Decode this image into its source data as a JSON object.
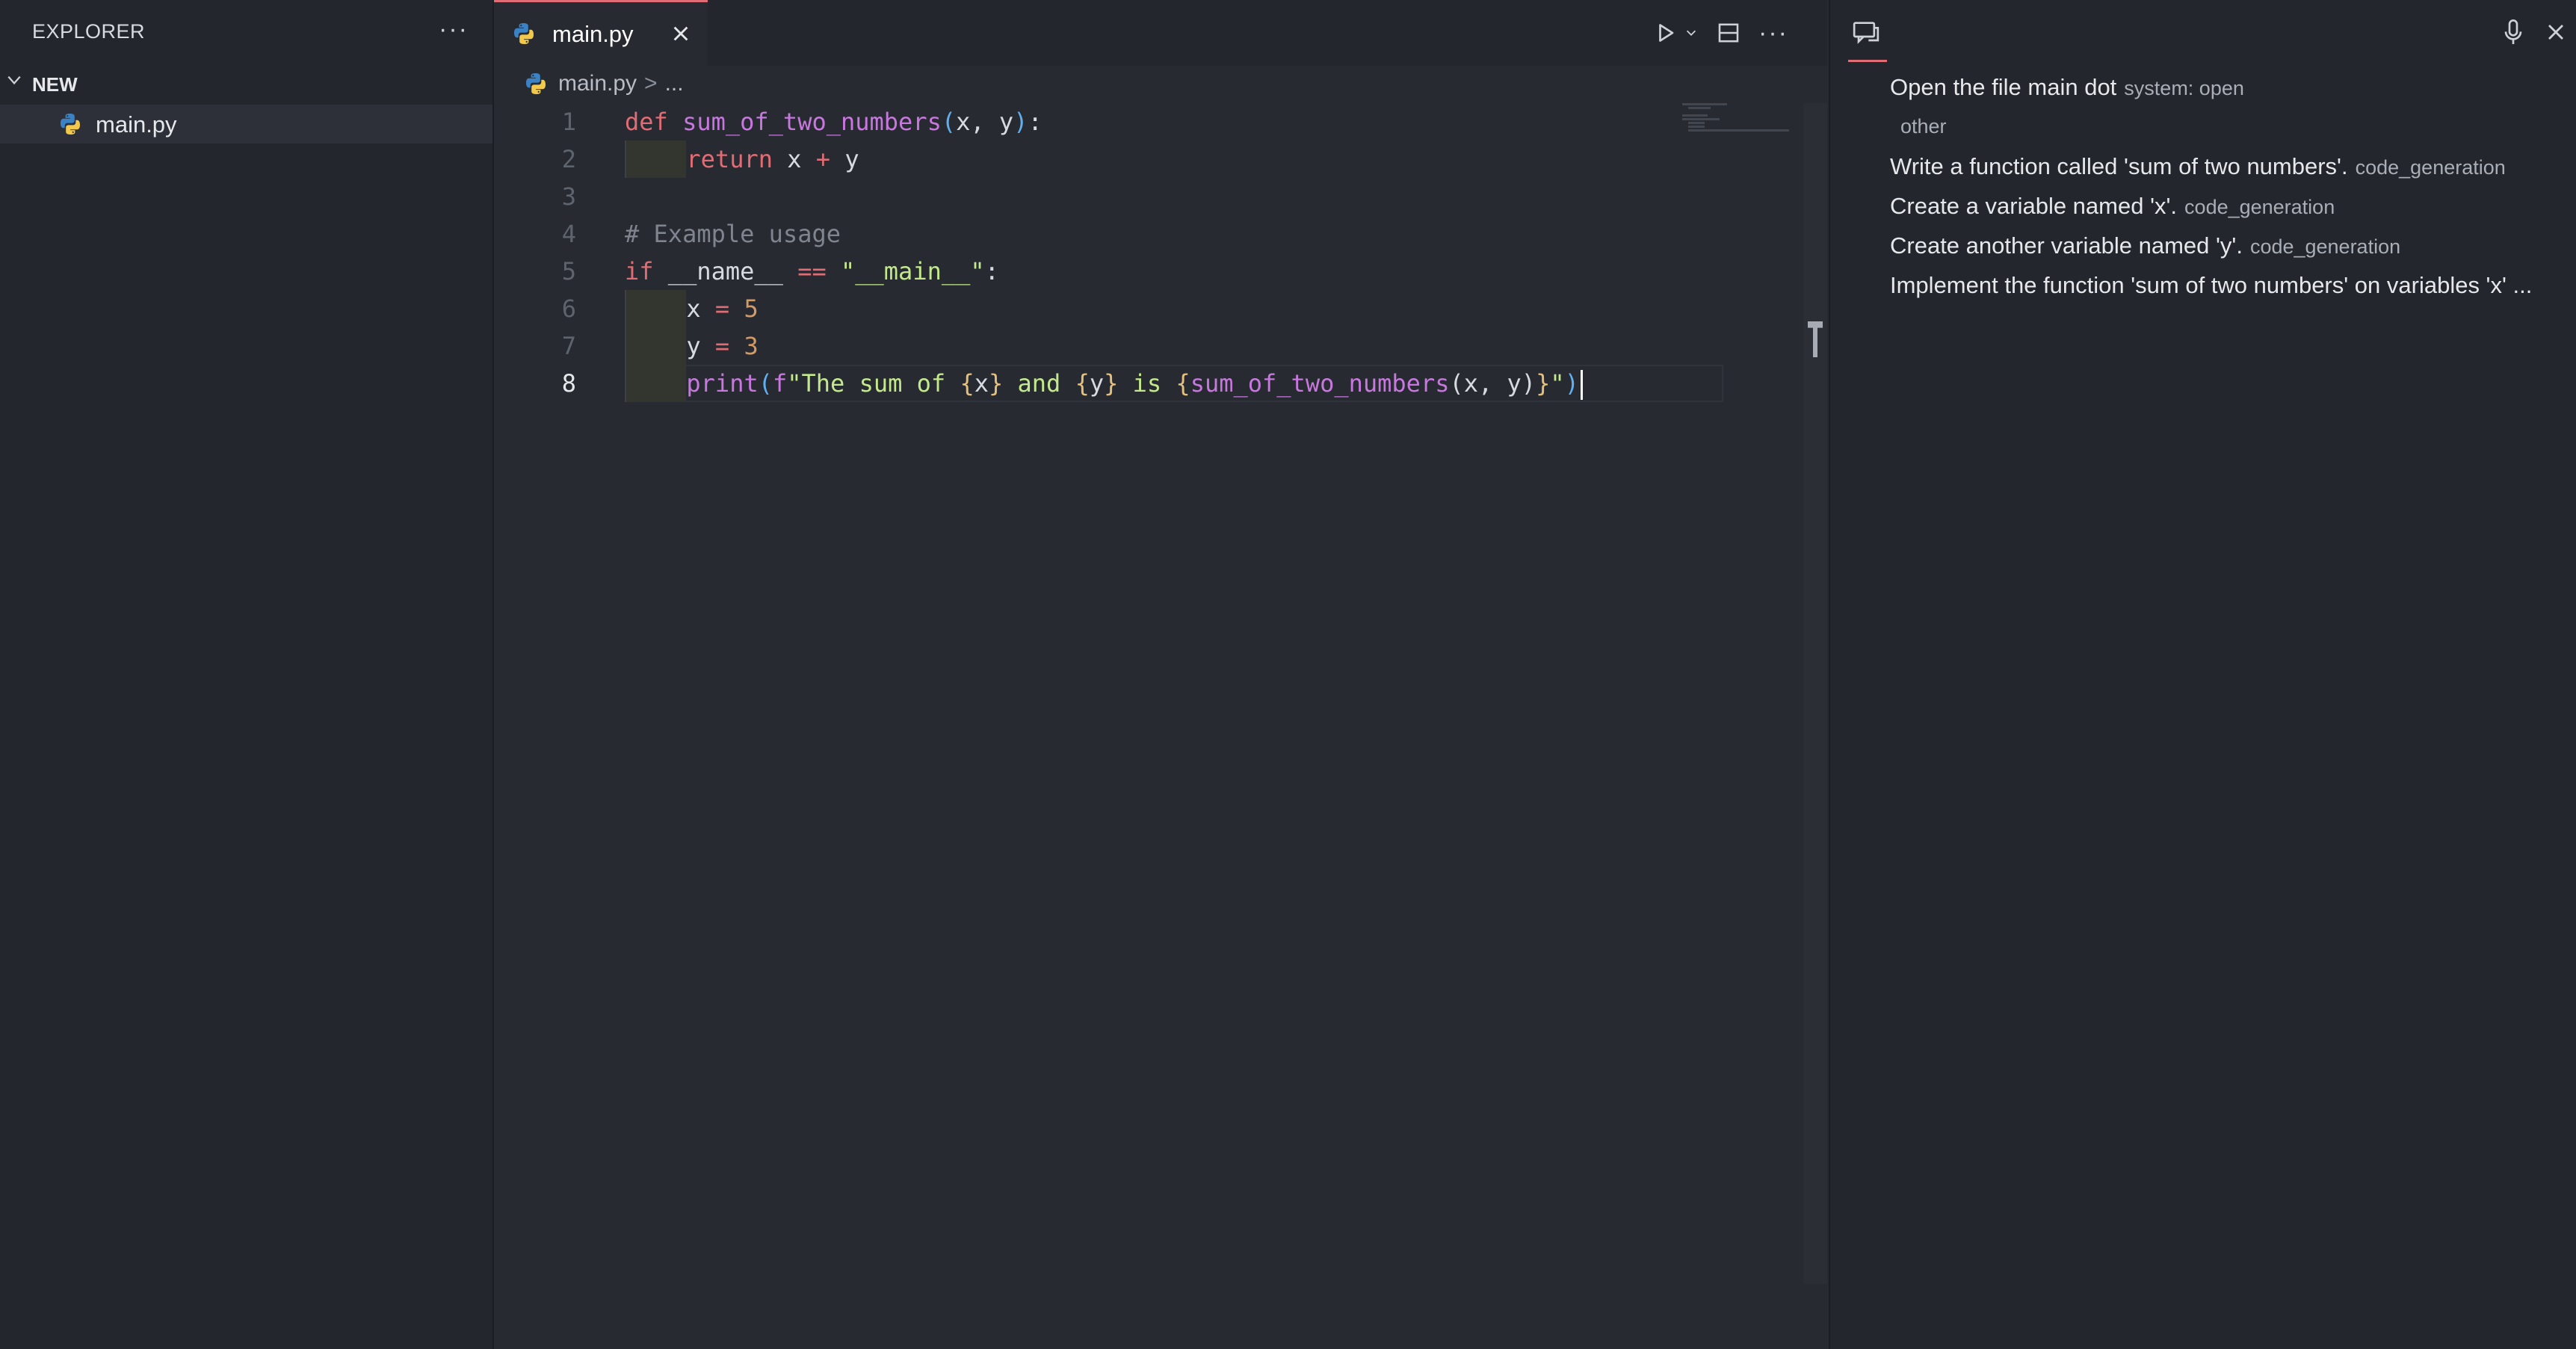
{
  "explorer": {
    "title": "EXPLORER",
    "more_label": "···",
    "folder_name": "NEW",
    "files": [
      {
        "name": "main.py",
        "icon": "python-file-icon"
      }
    ]
  },
  "editor": {
    "tab_label": "main.py",
    "breadcrumb": {
      "file": "main.py",
      "separator": ">",
      "trail": "..."
    },
    "code_lines": [
      {
        "number": "1",
        "text": "def sum_of_two_numbers(x, y):"
      },
      {
        "number": "2",
        "text": "    return x + y"
      },
      {
        "number": "3",
        "text": ""
      },
      {
        "number": "4",
        "text": "# Example usage"
      },
      {
        "number": "5",
        "text": "if __name__ == \"__main__\":"
      },
      {
        "number": "6",
        "text": "    x = 5"
      },
      {
        "number": "7",
        "text": "    y = 3"
      },
      {
        "number": "8",
        "text": "    print(f\"The sum of {x} and {y} is {sum_of_two_numbers(x, y)}\")"
      }
    ],
    "active_line": "8",
    "more_label": "···"
  },
  "chat": {
    "messages": [
      {
        "text": "Open the file main dot",
        "tag": "system: open"
      },
      {
        "text": "",
        "tag": "other"
      },
      {
        "text": "Write a function called 'sum of two numbers'.",
        "tag": "code_generation"
      },
      {
        "text": "Create a variable named 'x'.",
        "tag": "code_generation"
      },
      {
        "text": "Create another variable named 'y'.",
        "tag": "code_generation"
      },
      {
        "text": "Implement the function 'sum of two numbers' on variables 'x' ...",
        "tag": ""
      }
    ]
  },
  "colors": {
    "accent": "#e06c75",
    "keyword": "#e06c75",
    "function": "#c678dd",
    "parameter": "#e5c07b",
    "number": "#d19a66",
    "string": "#98c379",
    "comment": "#7f848e"
  }
}
